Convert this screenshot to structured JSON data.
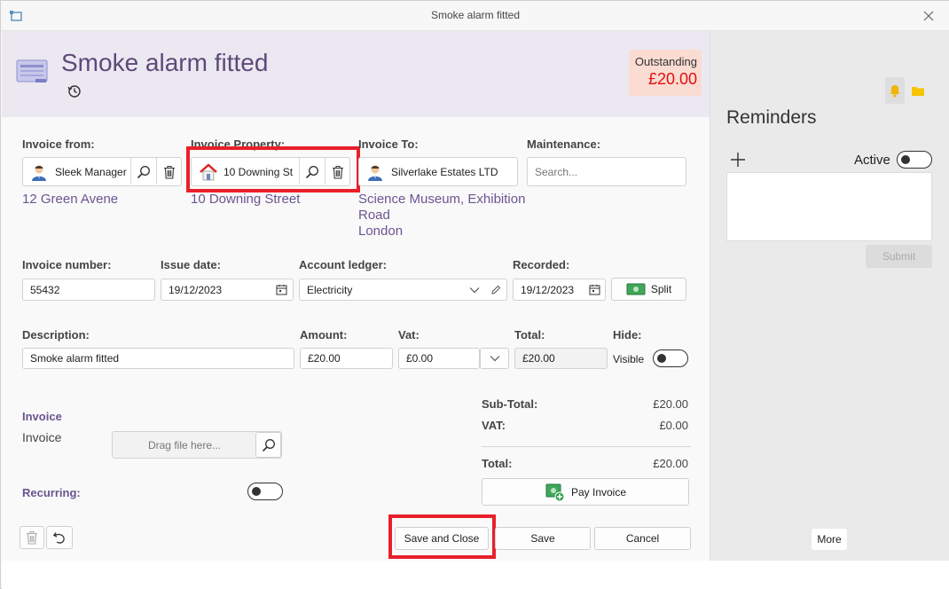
{
  "window": {
    "title": "Smoke alarm fitted"
  },
  "header": {
    "title": "Smoke alarm fitted",
    "outstanding_label": "Outstanding",
    "outstanding_amount": "£20.00"
  },
  "parties": {
    "invoice_from": {
      "label": "Invoice from:",
      "value": "Sleek Manager",
      "address": "12 Green Avene"
    },
    "invoice_property": {
      "label": "Invoice Property:",
      "value": "10 Downing St",
      "address": "10 Downing Street"
    },
    "invoice_to": {
      "label": "Invoice To:",
      "value": "Silverlake Estates LTD",
      "address_lines": [
        "Science Museum, Exhibition",
        "Road",
        "London"
      ]
    },
    "maintenance": {
      "label": "Maintenance:",
      "placeholder": "Search..."
    }
  },
  "row2": {
    "invoice_number": {
      "label": "Invoice number:",
      "value": "55432"
    },
    "issue_date": {
      "label": "Issue date:",
      "value": "19/12/2023"
    },
    "account_ledger": {
      "label": "Account ledger:",
      "value": "Electricity"
    },
    "recorded": {
      "label": "Recorded:",
      "value": "19/12/2023"
    },
    "split_label": "Split"
  },
  "row3": {
    "description": {
      "label": "Description:",
      "value": "Smoke alarm fitted"
    },
    "amount": {
      "label": "Amount:",
      "value": "£20.00"
    },
    "vat": {
      "label": "Vat:",
      "value": "£0.00"
    },
    "total": {
      "label": "Total:",
      "value": "£20.00"
    },
    "hide": {
      "label": "Hide:",
      "toggle_label": "Visible"
    }
  },
  "attachments": {
    "section_label": "Invoice",
    "item_label": "Invoice",
    "drop_placeholder": "Drag file here...",
    "recurring_label": "Recurring:"
  },
  "totals": {
    "subtotal_label": "Sub-Total:",
    "subtotal_value": "£20.00",
    "vat_label": "VAT:",
    "vat_value": "£0.00",
    "total_label": "Total:",
    "total_value": "£20.00",
    "pay_label": "Pay Invoice"
  },
  "footer": {
    "save_close": "Save and Close",
    "save": "Save",
    "cancel": "Cancel"
  },
  "reminders": {
    "title": "Reminders",
    "active_label": "Active",
    "submit_label": "Submit",
    "more_label": "More"
  },
  "colors": {
    "accent": "#6a5590",
    "highlight": "#e8202a",
    "outstanding_bg": "#fadcd2",
    "outstanding_text": "#e01010"
  }
}
